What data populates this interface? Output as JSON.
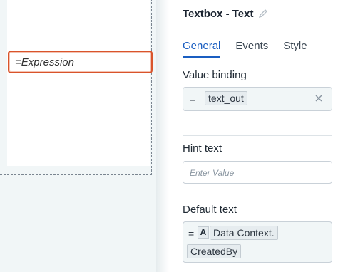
{
  "canvas": {
    "expression_text": "=Expression"
  },
  "panel": {
    "title": "Textbox - Text",
    "tabs": [
      {
        "label": "General",
        "active": true
      },
      {
        "label": "Events",
        "active": false
      },
      {
        "label": "Style",
        "active": false
      }
    ],
    "value_binding": {
      "label": "Value binding",
      "prefix": "=",
      "value": "text_out"
    },
    "hint_text": {
      "label": "Hint text",
      "placeholder": "Enter Value"
    },
    "default_text": {
      "label": "Default text",
      "prefix": "=",
      "type_icon": "A",
      "line1": "Data Context.",
      "line2": "CreatedBy"
    }
  },
  "colors": {
    "accent": "#1a5ec1",
    "selection": "#d9542b",
    "canvas_bg": "#f1f6f7"
  }
}
